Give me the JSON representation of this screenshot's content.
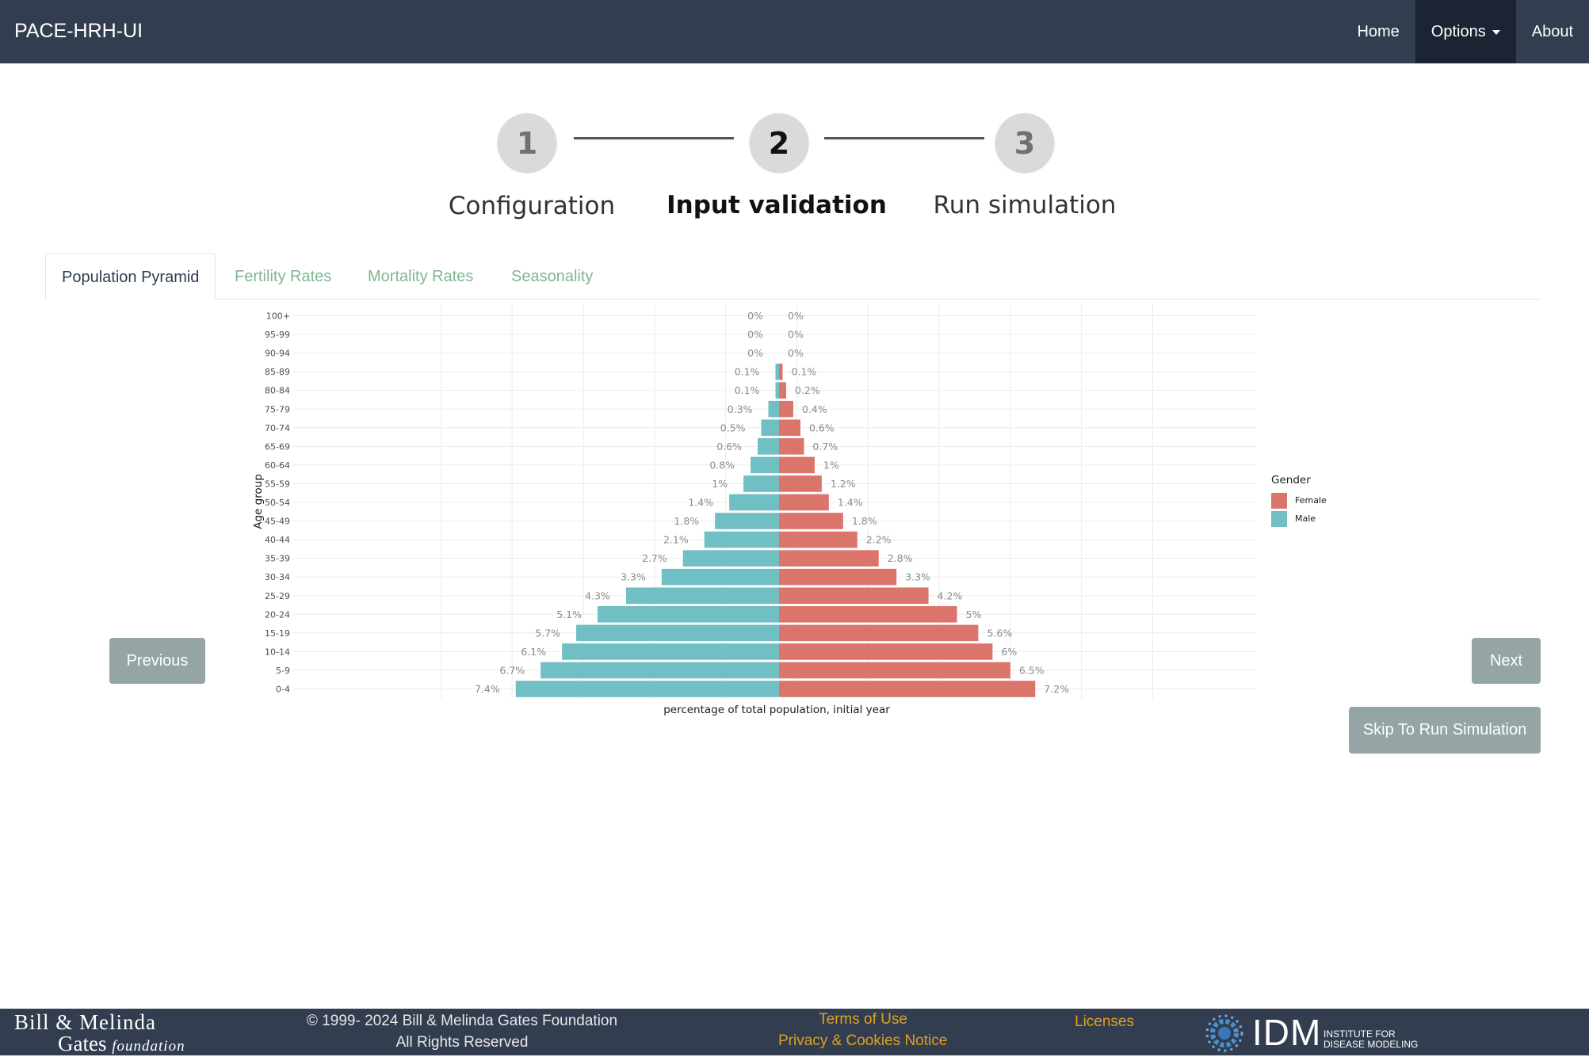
{
  "navbar": {
    "brand": "PACE-HRH-UI",
    "items": [
      {
        "label": "Home"
      },
      {
        "label": "Options"
      },
      {
        "label": "About"
      }
    ]
  },
  "stepper": {
    "steps": [
      {
        "number": "1",
        "label": "Configuration"
      },
      {
        "number": "2",
        "label": "Input validation"
      },
      {
        "number": "3",
        "label": "Run simulation"
      }
    ],
    "current": 2
  },
  "tabs": [
    {
      "label": "Population Pyramid",
      "active": true
    },
    {
      "label": "Fertility Rates"
    },
    {
      "label": "Mortality Rates"
    },
    {
      "label": "Seasonality"
    }
  ],
  "buttons": {
    "previous": "Previous",
    "next": "Next",
    "skip": "Skip To Run Simulation"
  },
  "chart_data": {
    "type": "bar",
    "orientation": "horizontal-pyramid",
    "xlabel": "percentage of total population, initial year",
    "ylabel": "Age group",
    "categories": [
      "100+",
      "95-99",
      "90-94",
      "85-89",
      "80-84",
      "75-79",
      "70-74",
      "65-69",
      "60-64",
      "55-59",
      "50-54",
      "45-49",
      "40-44",
      "35-39",
      "30-34",
      "25-29",
      "20-24",
      "15-19",
      "10-14",
      "5-9",
      "0-4"
    ],
    "series": [
      {
        "name": "Male",
        "color": "#6fbfc5",
        "side": "left",
        "values": [
          0,
          0,
          0,
          0.1,
          0.1,
          0.3,
          0.5,
          0.6,
          0.8,
          1,
          1.4,
          1.8,
          2.1,
          2.7,
          3.3,
          4.3,
          5.1,
          5.7,
          6.1,
          6.7,
          7.4
        ],
        "labels": [
          "0%",
          "0%",
          "0%",
          "0.1%",
          "0.1%",
          "0.3%",
          "0.5%",
          "0.6%",
          "0.8%",
          "1%",
          "1.4%",
          "1.8%",
          "2.1%",
          "2.7%",
          "3.3%",
          "4.3%",
          "5.1%",
          "5.7%",
          "6.1%",
          "6.7%",
          "7.4%"
        ]
      },
      {
        "name": "Female",
        "color": "#db756b",
        "side": "right",
        "values": [
          0,
          0,
          0,
          0.1,
          0.2,
          0.4,
          0.6,
          0.7,
          1,
          1.2,
          1.4,
          1.8,
          2.2,
          2.8,
          3.3,
          4.2,
          5,
          5.6,
          6,
          6.5,
          7.2
        ],
        "labels": [
          "0%",
          "0%",
          "0%",
          "0.1%",
          "0.2%",
          "0.4%",
          "0.6%",
          "0.7%",
          "1%",
          "1.2%",
          "1.4%",
          "1.8%",
          "2.2%",
          "2.8%",
          "3.3%",
          "4.2%",
          "5%",
          "5.6%",
          "6%",
          "6.5%",
          "7.2%"
        ]
      }
    ],
    "legend": {
      "title": "Gender",
      "position": "right",
      "entries": [
        "Female",
        "Male"
      ]
    },
    "grid": true,
    "xlim": [
      -12.5,
      12.5
    ]
  },
  "footer": {
    "logo_line1": "Bill & Melinda",
    "logo_line2": "Gates",
    "logo_line2_italic": "foundation",
    "copyright_line1": "© 1999- 2024 Bill & Melinda Gates Foundation",
    "copyright_line2": "All Rights Reserved",
    "terms": "Terms of Use",
    "privacy": "Privacy & Cookies Notice",
    "licenses": "Licenses",
    "idm_name": "IDM",
    "idm_sub1": "INSTITUTE FOR",
    "idm_sub2": "DISEASE MODELING"
  }
}
